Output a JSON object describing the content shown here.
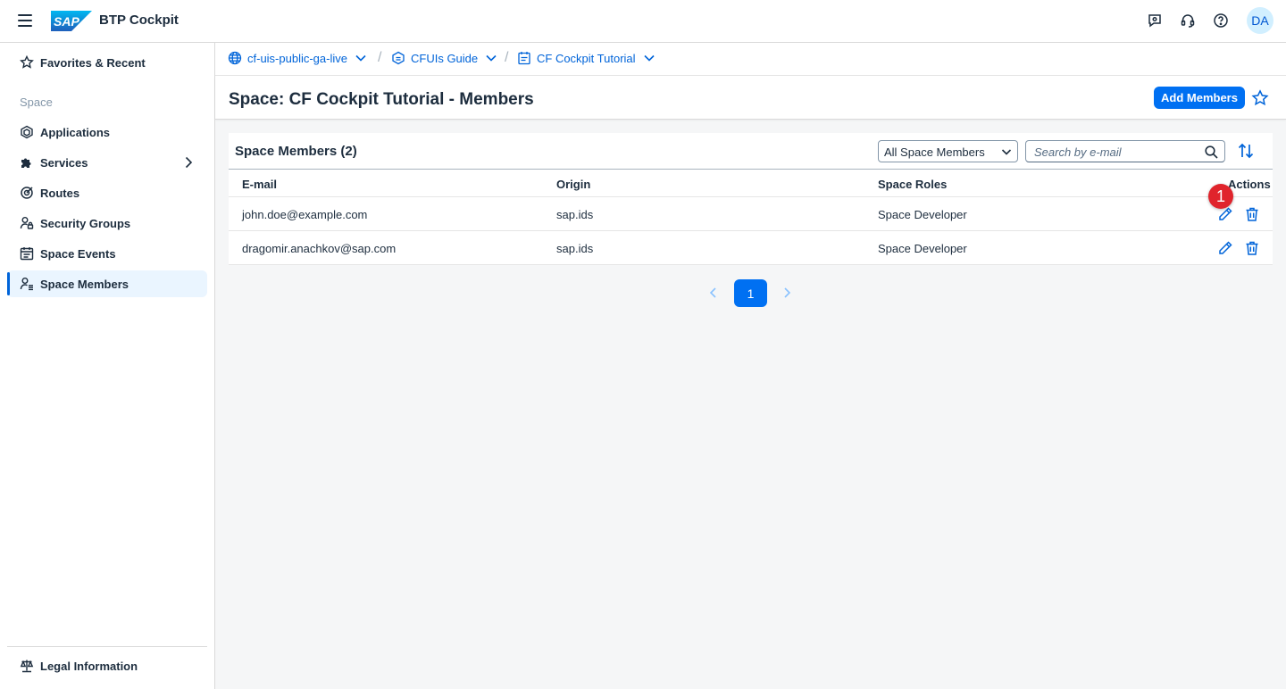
{
  "shell": {
    "logo_text": "SAP",
    "title": "BTP Cockpit",
    "avatar_initials": "DA",
    "icons": [
      "menu-icon",
      "feedback-icon",
      "support-headset-icon",
      "help-icon"
    ]
  },
  "sidebar": {
    "favorites": "Favorites & Recent",
    "group_label": "Space",
    "items": [
      {
        "label": "Applications",
        "icon": "applications-icon"
      },
      {
        "label": "Services",
        "icon": "services-icon"
      },
      {
        "label": "Routes",
        "icon": "routes-icon"
      },
      {
        "label": "Security Groups",
        "icon": "security-groups-icon"
      },
      {
        "label": "Space Events",
        "icon": "space-events-icon"
      },
      {
        "label": "Space Members",
        "icon": "space-members-icon",
        "selected": true
      }
    ],
    "legal": "Legal Information"
  },
  "breadcrumb": {
    "items": [
      {
        "label": "cf-uis-public-ga-live",
        "icon": "globe-icon"
      },
      {
        "label": "CFUIs Guide",
        "icon": "org-icon"
      },
      {
        "label": "CF Cockpit Tutorial",
        "icon": "space-icon"
      }
    ]
  },
  "header": {
    "title": "Space: CF Cockpit Tutorial - Members",
    "add_button": "Add Members"
  },
  "table": {
    "title": "Space Members (2)",
    "filter_value": "All Space Members",
    "search_placeholder": "Search by e-mail",
    "columns": [
      "E-mail",
      "Origin",
      "Space Roles",
      "Actions"
    ],
    "rows": [
      {
        "email": "john.doe@example.com",
        "origin": "sap.ids",
        "role": "Space Developer"
      },
      {
        "email": "dragomir.anachkov@sap.com",
        "origin": "sap.ids",
        "role": "Space Developer"
      }
    ]
  },
  "annotation": {
    "badge": "1"
  },
  "pagination": {
    "current": "1"
  },
  "colors": {
    "accent": "#0070f2",
    "link": "#0064d9",
    "badge": "#e0242c",
    "selected_bg": "#eaf5ff"
  }
}
